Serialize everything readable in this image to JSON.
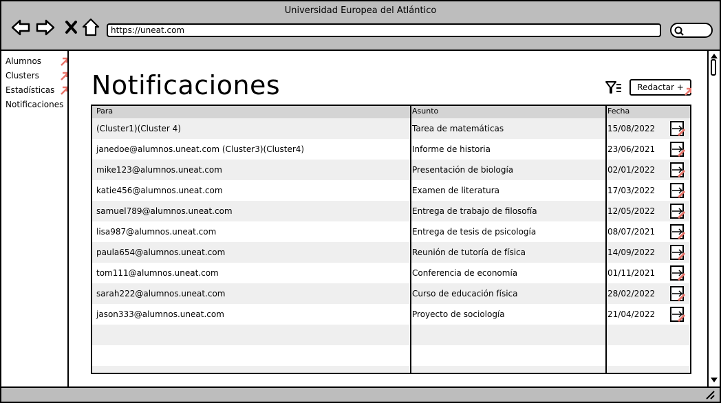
{
  "window": {
    "title": "Universidad Europea del Atlántico"
  },
  "browser": {
    "url": "https://uneat.com",
    "icons": [
      "back-arrow-icon",
      "forward-arrow-icon",
      "close-x-icon",
      "home-icon",
      "search-icon"
    ]
  },
  "sidebar": {
    "items": [
      {
        "label": "Alumnos"
      },
      {
        "label": "Clusters"
      },
      {
        "label": "Estadísticas"
      },
      {
        "label": "Notificaciones"
      }
    ]
  },
  "main": {
    "title": "Notificaciones",
    "compose_label": "Redactar +",
    "filter_icon": "filter-icon"
  },
  "table": {
    "headers": {
      "para": "Para",
      "asunto": "Asunto",
      "fecha": "Fecha"
    },
    "rows": [
      {
        "para": "(Cluster1)(Cluster 4)",
        "asunto": "Tarea de matemáticas",
        "fecha": "15/08/2022"
      },
      {
        "para": "janedoe@alumnos.uneat.com (Cluster3)(Cluster4)",
        "asunto": "Informe de historia",
        "fecha": "23/06/2021"
      },
      {
        "para": "mike123@alumnos.uneat.com",
        "asunto": "Presentación de biología",
        "fecha": "02/01/2022"
      },
      {
        "para": "katie456@alumnos.uneat.com",
        "asunto": "Examen de literatura",
        "fecha": "17/03/2022"
      },
      {
        "para": "samuel789@alumnos.uneat.com",
        "asunto": "Entrega de trabajo de filosofía",
        "fecha": "12/05/2022"
      },
      {
        "para": "lisa987@alumnos.uneat.com",
        "asunto": "Entrega de tesis de psicología",
        "fecha": "08/07/2021"
      },
      {
        "para": "paula654@alumnos.uneat.com",
        "asunto": "Reunión de tutoría de física",
        "fecha": "14/09/2022"
      },
      {
        "para": "tom111@alumnos.uneat.com",
        "asunto": "Conferencia de economía",
        "fecha": "01/11/2021"
      },
      {
        "para": "sarah222@alumnos.uneat.com",
        "asunto": "Curso de educación física",
        "fecha": "28/02/2022"
      },
      {
        "para": "jason333@alumnos.uneat.com",
        "asunto": "Proyecto de sociología",
        "fecha": "21/04/2022"
      }
    ]
  },
  "colors": {
    "chrome": "#bdbdbd",
    "accent": "#e8746a",
    "row_alt": "#efefef"
  }
}
